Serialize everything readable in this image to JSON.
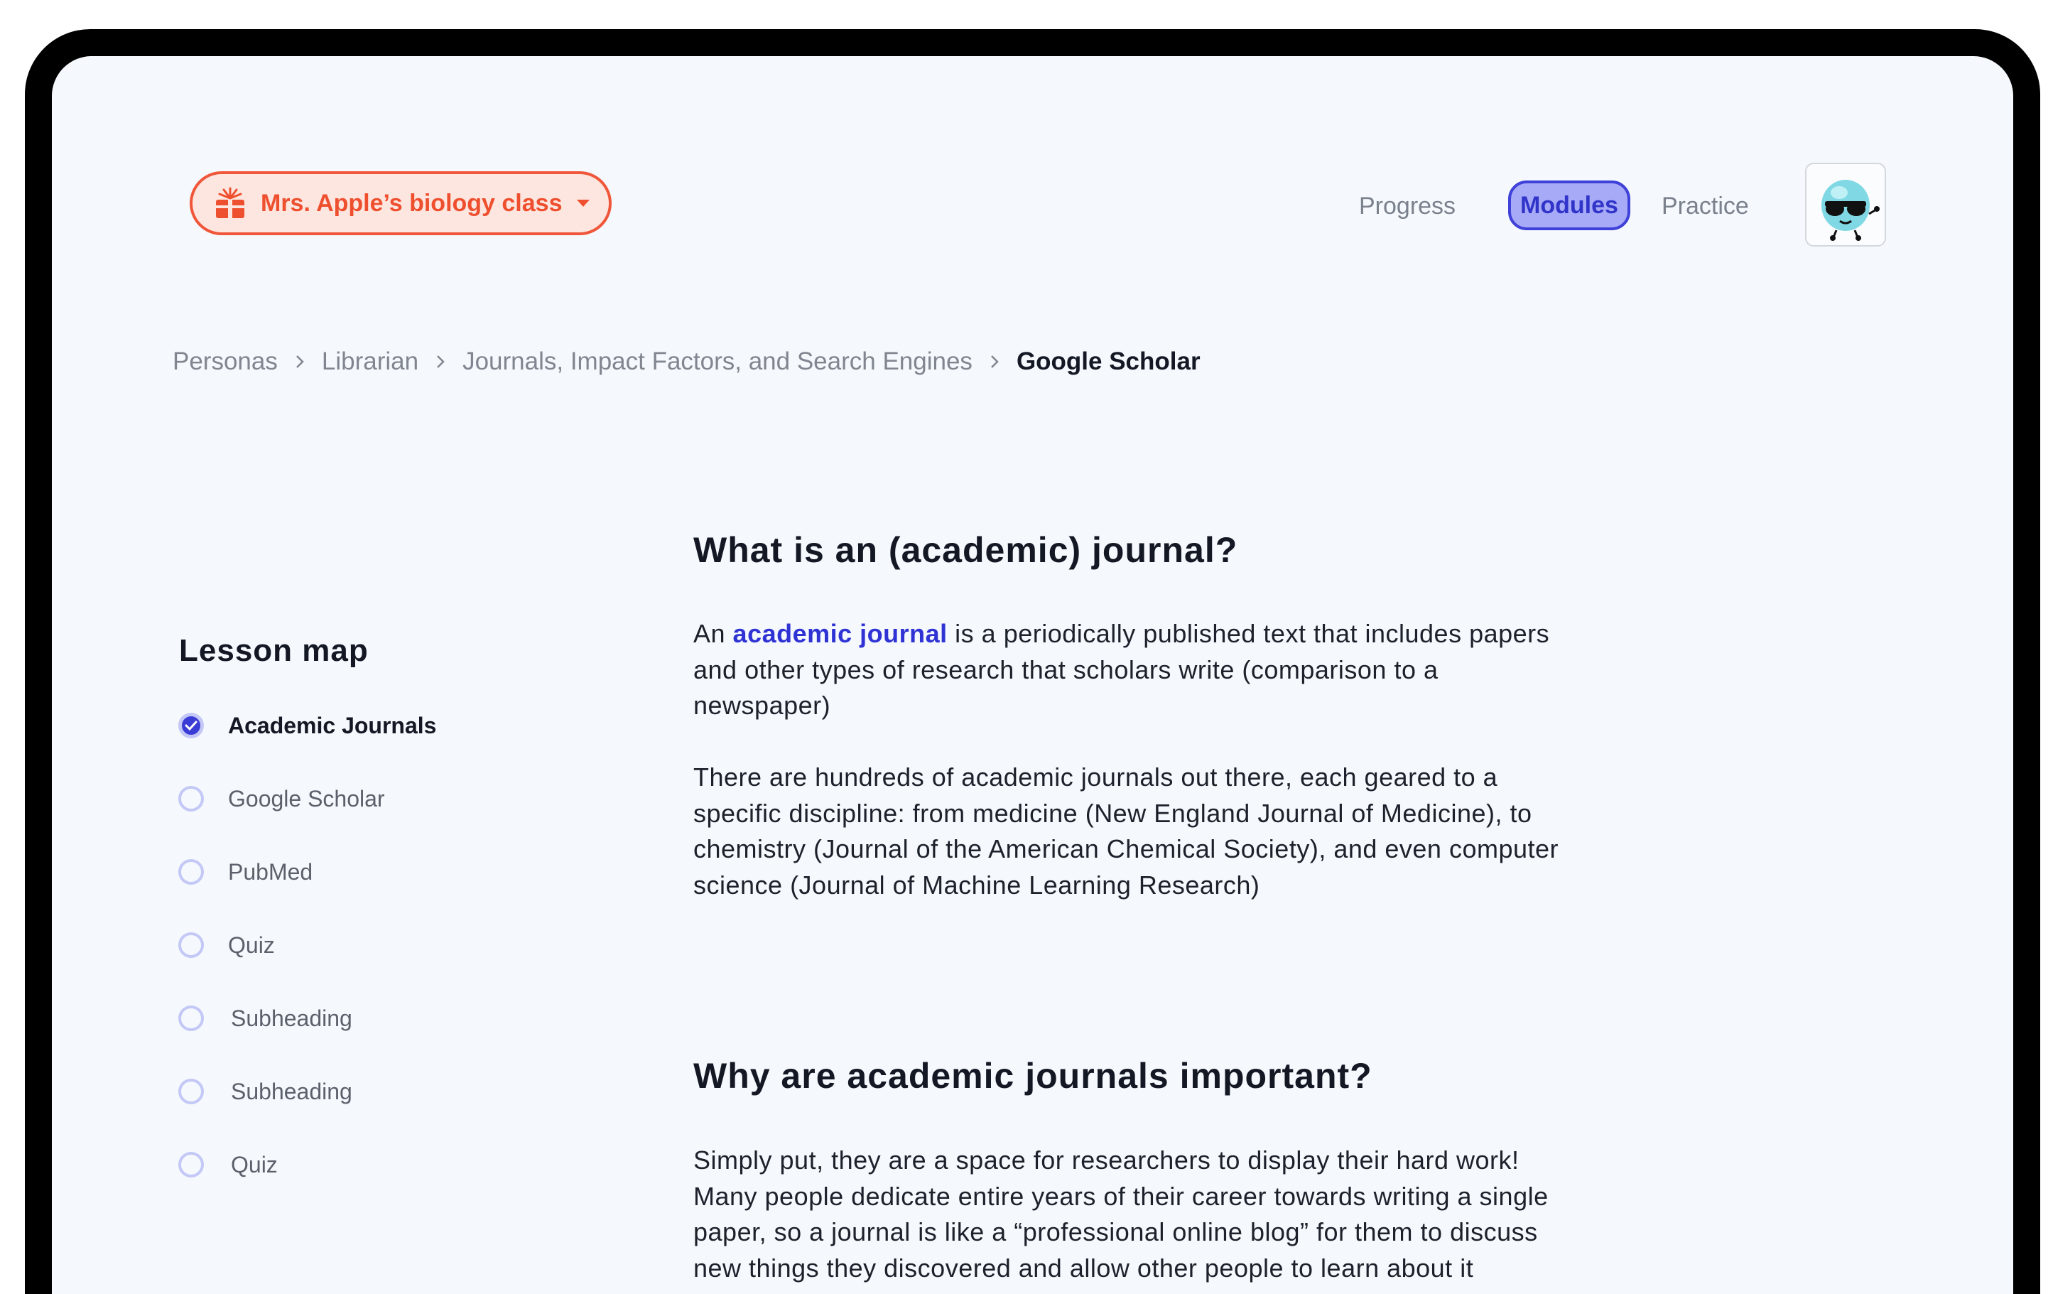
{
  "header": {
    "class_selector": {
      "label": "Mrs. Apple’s biology class",
      "icon": "gift-icon",
      "caret": "caret-down-icon"
    },
    "nav": [
      {
        "label": "Progress",
        "active": false
      },
      {
        "label": "Modules",
        "active": true
      },
      {
        "label": "Practice",
        "active": false
      }
    ],
    "avatar": "mascot-avatar"
  },
  "breadcrumb": {
    "items": [
      "Personas",
      "Librarian",
      "Journals, Impact Factors, and Search Engines"
    ],
    "current": "Google Scholar"
  },
  "lesson_map": {
    "title": "Lesson map",
    "items": [
      {
        "label": "Academic Journals",
        "completed": true
      },
      {
        "label": "Google Scholar",
        "completed": false
      },
      {
        "label": "PubMed",
        "completed": false
      },
      {
        "label": "Quiz",
        "completed": false
      },
      {
        "label": "Subheading",
        "completed": false
      },
      {
        "label": "Subheading",
        "completed": false
      },
      {
        "label": "Quiz",
        "completed": false
      }
    ]
  },
  "content": {
    "section1": {
      "heading": "What is an (academic) journal?",
      "p1_prefix": "An ",
      "p1_link": "academic journal",
      "p1_suffix": " is a periodically published text that includes papers and other types of research that scholars write (comparison to a newspaper)",
      "p2": "There are hundreds of academic journals out there, each geared to a specific discipline: from medicine  (New England Journal of Medicine), to chemistry (Journal of the American Chemical Society), and even computer science (Journal of Machine Learning Research)"
    },
    "section2": {
      "heading": "Why are academic journals important?",
      "p1": "Simply put, they are a space for researchers to display their hard work! Many people dedicate entire years of their career towards writing a single paper, so a journal is like a “professional online blog” for them to discuss new things they discovered and allow other people to learn about it"
    }
  },
  "colors": {
    "accent": "#3a3cd6",
    "class_pill": "#ee4f2e",
    "background": "#f5f9fd"
  }
}
